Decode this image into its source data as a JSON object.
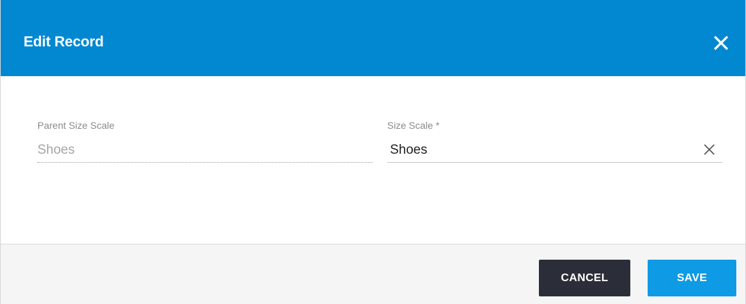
{
  "dialog": {
    "title": "Edit Record",
    "close_icon": "close-icon"
  },
  "fields": {
    "parent_size_scale": {
      "label": "Parent Size Scale",
      "value": "Shoes"
    },
    "size_scale": {
      "label": "Size Scale *",
      "value": "Shoes",
      "clear_icon": "clear-icon"
    }
  },
  "footer": {
    "cancel_label": "CANCEL",
    "save_label": "SAVE"
  },
  "colors": {
    "header": "#0288d1",
    "cancel_button": "#2b2e38",
    "save_button": "#0e9ae5"
  }
}
